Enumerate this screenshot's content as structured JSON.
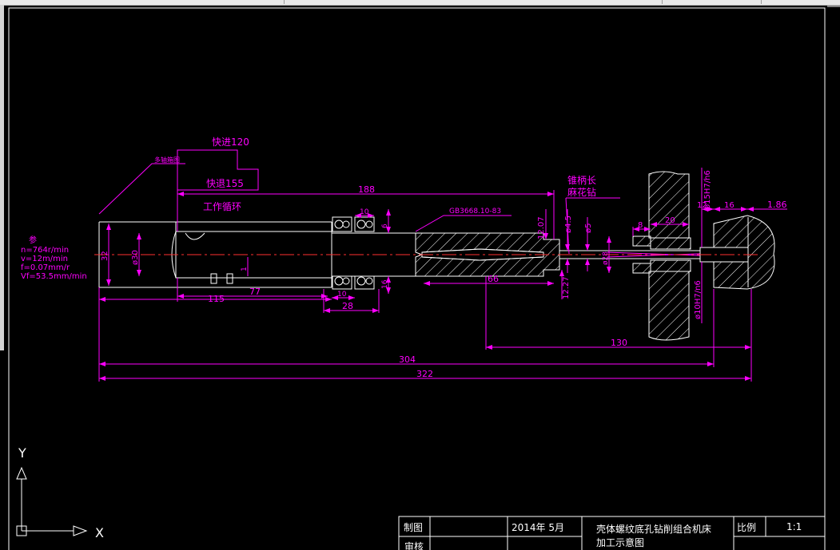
{
  "colors": {
    "background": "#000000",
    "outline": "#ffffff",
    "dimension": "#ff00ff",
    "centerline": "#ff3030",
    "frame": "#ffffff"
  },
  "drawing": {
    "note_label": "多轴箱图",
    "fast_forward": "快进120",
    "fast_return": "快退155",
    "work_cycle": "工作循环",
    "tool_label_line1": "锥柄长",
    "tool_label_line2": "麻花钻",
    "standard": "GB3668.10-83",
    "params": {
      "title": "参",
      "lines": [
        "n=764r/min",
        "v=12m/min",
        "f=0.07mm/r",
        "Vf=53.5mm/min"
      ]
    },
    "dimensions": {
      "d188": "188",
      "d10_top": "10",
      "d10_bottom": "10",
      "d115": "115",
      "d77": "77",
      "d28": "28",
      "d66": "66",
      "d304": "304",
      "d322": "322",
      "d130": "130",
      "d8": "8",
      "d20": "20",
      "d12": "12",
      "d16": "16",
      "d1_86": "1.86",
      "d12_07": "12.07",
      "d12_27": "12.27",
      "d4_5": "ø4.5",
      "d5": "ø5",
      "d30": "ø30",
      "d32": "32",
      "d6": "6",
      "d16_side": "16",
      "d1": "1",
      "d28_small": "ø28",
      "fit_top": "ø15H7/h6",
      "fit_bottom": "ø10H7/n6"
    }
  },
  "ucs": {
    "y_label": "Y",
    "x_label": "X"
  },
  "title_block": {
    "drawn_label": "制图",
    "date": "2014年  5月",
    "title_line1": "壳体螺纹底孔钻削组合机床",
    "title_line2": "加工示意图",
    "scale_label": "比例",
    "scale_value": "1:1",
    "check_label": "审核"
  }
}
